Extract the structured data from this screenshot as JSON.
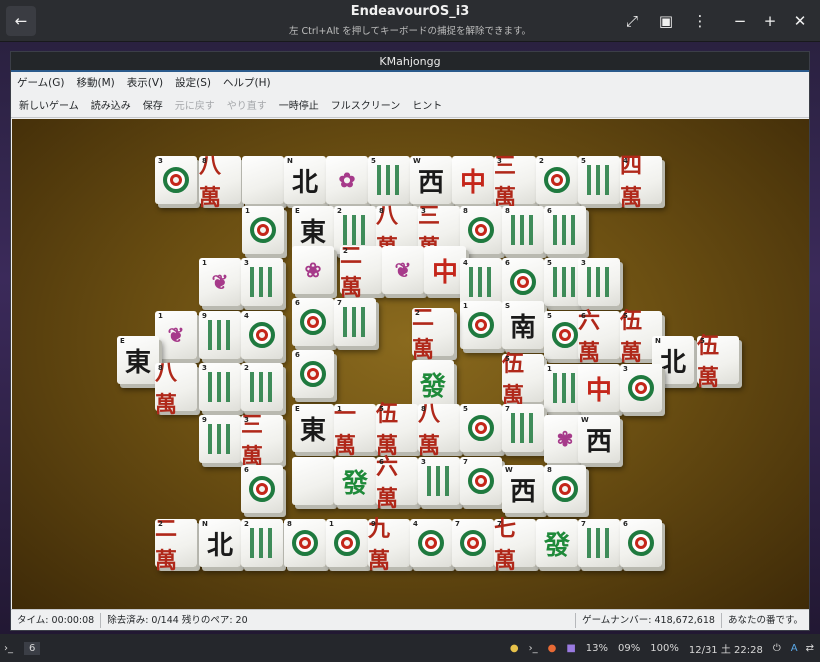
{
  "vm": {
    "title": "EndeavourOS_i3",
    "subtitle": "左 Ctrl+Alt を押してキーボードの捕捉を解除できます。"
  },
  "window": {
    "title": "KMahjongg"
  },
  "menu": [
    "ゲーム(G)",
    "移動(M)",
    "表示(V)",
    "設定(S)",
    "ヘルプ(H)"
  ],
  "toolbar": [
    {
      "label": "新しいゲーム",
      "enabled": true
    },
    {
      "label": "読み込み",
      "enabled": true
    },
    {
      "label": "保存",
      "enabled": true
    },
    {
      "label": "元に戻す",
      "enabled": false
    },
    {
      "label": "やり直す",
      "enabled": false
    },
    {
      "label": "一時停止",
      "enabled": true
    },
    {
      "label": "フルスクリーン",
      "enabled": true
    },
    {
      "label": "ヒント",
      "enabled": true
    }
  ],
  "status": {
    "time": "タイム: 00:00:08",
    "removed": "除去済み: 0/144 残りのペア: 20",
    "game_number": "ゲームナンバー: 418,672,618",
    "turn": "あなたの番です。"
  },
  "taskbar": {
    "workspace": "6",
    "battery": "13%",
    "brightness": "09%",
    "volume": "100%",
    "clock": "12/31 土 22:28"
  },
  "tiles": [
    {
      "k": "dots",
      "i": "3"
    },
    {
      "k": "man",
      "g": "八萬",
      "i": "8"
    },
    {
      "k": "blank"
    },
    {
      "k": "wind",
      "g": "北",
      "i": "N"
    },
    {
      "k": "flower",
      "g": "✿"
    },
    {
      "k": "bam",
      "i": "5"
    },
    {
      "k": "wind",
      "g": "西",
      "i": "W"
    },
    {
      "k": "dragon-r",
      "g": "中"
    },
    {
      "k": "man",
      "g": "三萬",
      "i": "3"
    },
    {
      "k": "dots",
      "i": "2"
    },
    {
      "k": "bam",
      "i": "5"
    },
    {
      "k": "man",
      "g": "四萬",
      "i": "4"
    },
    {
      "k": "dots",
      "i": "1"
    },
    {
      "k": "wind",
      "g": "東",
      "i": "E"
    },
    {
      "k": "bam",
      "i": "2"
    },
    {
      "k": "man",
      "g": "八萬",
      "i": "8"
    },
    {
      "k": "man",
      "g": "三萬",
      "i": "3"
    },
    {
      "k": "dots",
      "i": "8"
    },
    {
      "k": "bam",
      "i": "8"
    },
    {
      "k": "bam",
      "i": "6"
    },
    {
      "k": "flower",
      "g": "❦",
      "i": "1"
    },
    {
      "k": "bam",
      "i": "3"
    },
    {
      "k": "flower",
      "g": "❀"
    },
    {
      "k": "man",
      "g": "二萬",
      "i": "2"
    },
    {
      "k": "flower",
      "g": "❦"
    },
    {
      "k": "dragon-r",
      "g": "中"
    },
    {
      "k": "bam",
      "i": "4"
    },
    {
      "k": "dots",
      "i": "6"
    },
    {
      "k": "bam",
      "i": "5"
    },
    {
      "k": "bam",
      "i": "3"
    },
    {
      "k": "flower",
      "g": "❦",
      "i": "1"
    },
    {
      "k": "bam",
      "i": "9"
    },
    {
      "k": "dots",
      "i": "4"
    },
    {
      "k": "dots",
      "i": "6"
    },
    {
      "k": "bam",
      "i": "7"
    },
    {
      "k": "man",
      "g": "二萬",
      "i": "2"
    },
    {
      "k": "dots",
      "i": "1"
    },
    {
      "k": "wind",
      "g": "南",
      "i": "S"
    },
    {
      "k": "dots",
      "i": "5"
    },
    {
      "k": "man",
      "g": "六萬",
      "i": "6"
    },
    {
      "k": "man",
      "g": "伍萬",
      "i": "5"
    },
    {
      "k": "wind",
      "g": "東",
      "i": "E"
    },
    {
      "k": "wind",
      "g": "北",
      "i": "N"
    },
    {
      "k": "man",
      "g": "伍萬",
      "i": "5"
    },
    {
      "k": "man",
      "g": "八萬",
      "i": "8"
    },
    {
      "k": "bam",
      "i": "3"
    },
    {
      "k": "bam",
      "i": "2"
    },
    {
      "k": "dots",
      "i": "6"
    },
    {
      "k": "dragon-g",
      "g": "發"
    },
    {
      "k": "man",
      "g": "伍萬",
      "i": "5"
    },
    {
      "k": "bam",
      "i": "1"
    },
    {
      "k": "dragon-r",
      "g": "中"
    },
    {
      "k": "dots",
      "i": "3"
    },
    {
      "k": "bam",
      "i": "9"
    },
    {
      "k": "man",
      "g": "三萬",
      "i": "3"
    },
    {
      "k": "wind",
      "g": "東",
      "i": "E"
    },
    {
      "k": "man",
      "g": "一萬",
      "i": "1"
    },
    {
      "k": "man",
      "g": "伍萬",
      "i": "5"
    },
    {
      "k": "man",
      "g": "八萬",
      "i": "8"
    },
    {
      "k": "dots",
      "i": "5"
    },
    {
      "k": "bam",
      "i": "7"
    },
    {
      "k": "flower",
      "g": "✾"
    },
    {
      "k": "wind",
      "g": "西",
      "i": "W"
    },
    {
      "k": "dots",
      "i": "6"
    },
    {
      "k": "blank"
    },
    {
      "k": "dragon-g",
      "g": "發"
    },
    {
      "k": "man",
      "g": "六萬",
      "i": "6"
    },
    {
      "k": "bam",
      "i": "3"
    },
    {
      "k": "dots",
      "i": "7"
    },
    {
      "k": "wind",
      "g": "西",
      "i": "W"
    },
    {
      "k": "dots",
      "i": "8"
    },
    {
      "k": "man",
      "g": "二萬",
      "i": "2"
    },
    {
      "k": "wind",
      "g": "北",
      "i": "N"
    },
    {
      "k": "bam",
      "i": "2"
    },
    {
      "k": "dots",
      "i": "8"
    },
    {
      "k": "dots",
      "i": "1"
    },
    {
      "k": "man",
      "g": "九萬",
      "i": "9"
    },
    {
      "k": "dots",
      "i": "4"
    },
    {
      "k": "dots",
      "i": "7"
    },
    {
      "k": "man",
      "g": "七萬",
      "i": "7"
    },
    {
      "k": "dragon-g",
      "g": "發"
    },
    {
      "k": "bam",
      "i": "7"
    },
    {
      "k": "dots",
      "i": "6"
    }
  ]
}
